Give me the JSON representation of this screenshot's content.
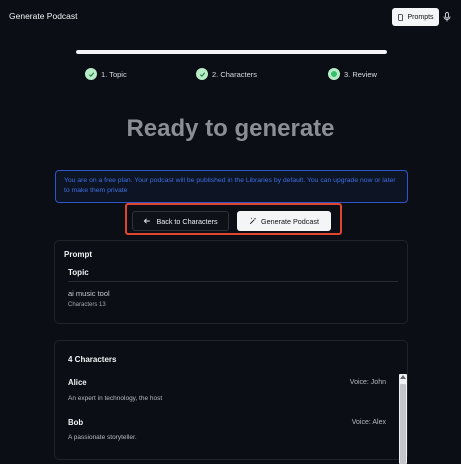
{
  "header": {
    "title": "Generate Podcast",
    "prompts_label": "Prompts"
  },
  "progress": {
    "fraction": 1.0
  },
  "steps": [
    {
      "label": "1. Topic",
      "state": "done"
    },
    {
      "label": "2. Characters",
      "state": "done"
    },
    {
      "label": "3. Review",
      "state": "current"
    }
  ],
  "main": {
    "headline": "Ready to generate",
    "notice": "You are on a free plan. Your podcast will be published in the Libraries by default. You can upgrade now or later to make them private",
    "back_label": "Back to Characters",
    "generate_label": "Generate Podcast"
  },
  "prompt": {
    "title": "Prompt",
    "topic_title": "Topic",
    "topic_value": "ai music tool",
    "characters_count": "Characters 13"
  },
  "characters": {
    "title": "4 Characters",
    "items": [
      {
        "name": "Alice",
        "voice": "Voice: John",
        "description": "An expert in technology, the host"
      },
      {
        "name": "Bob",
        "voice": "Voice: Alex",
        "description": "A passionate storyteller."
      }
    ]
  },
  "colors": {
    "background": "#0b0e15",
    "notice_border": "#2d57c8",
    "highlight": "#e1452f",
    "step_done": "#b7ecc7"
  }
}
